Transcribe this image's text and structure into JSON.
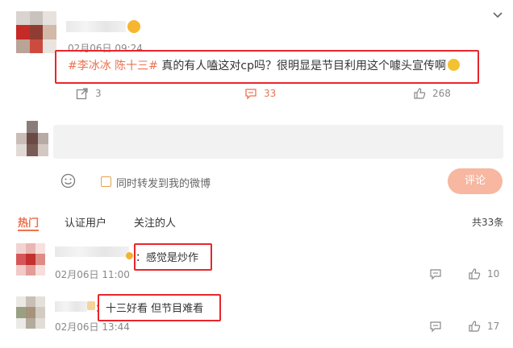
{
  "post": {
    "timestamp": "02月06日 09:24",
    "hashtag": "#李冰冰 陈十三#",
    "body": " 真的有人嗑这对cp吗？很明显是节目利用这个噱头宣传啊",
    "actions": {
      "repost": "3",
      "comment": "33",
      "like": "268"
    }
  },
  "composer": {
    "checkbox_label": "同时转发到我的微博",
    "submit_label": "评论"
  },
  "tabs": [
    {
      "label": "热门"
    },
    {
      "label": "认证用户"
    },
    {
      "label": "关注的人"
    }
  ],
  "total": "共33条",
  "comments": [
    {
      "text": "感觉是炒作",
      "time": "02月06日 11:00",
      "likes": "10"
    },
    {
      "text": "十三好看 但节目难看",
      "time": "02月06日 13:44",
      "likes": "17"
    }
  ],
  "colors": {
    "accent": "#eb7350",
    "highlight": "#e8262b",
    "submit_bg": "#f7b7a0"
  }
}
